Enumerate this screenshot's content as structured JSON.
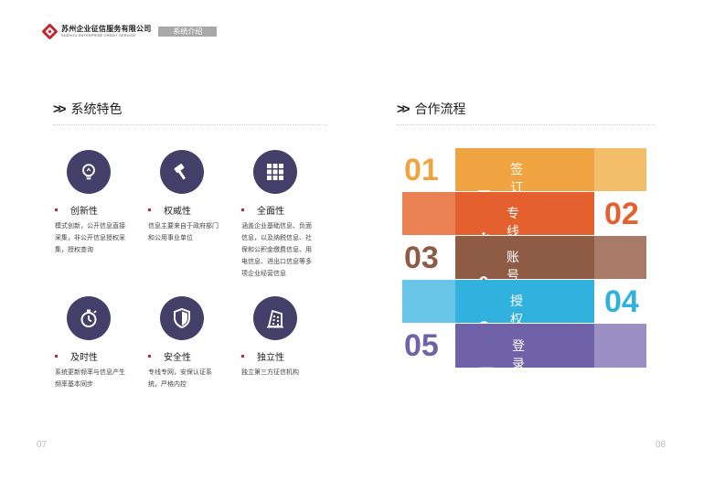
{
  "header": {
    "company_cn": "苏州企业征信服务有限公司",
    "company_en": "SUZHOU ENTERPRISE CREDIT SERVICE",
    "section_tag": "系统介绍"
  },
  "left": {
    "title": "系统特色",
    "features": [
      {
        "name": "创新性",
        "desc": "模式创新，公开信息直接采集，非公开信息授权采集，授权查询",
        "icon": "lightbulb-icon"
      },
      {
        "name": "权威性",
        "desc": "信息主要来自于政府部门和公用事业单位",
        "icon": "gavel-icon"
      },
      {
        "name": "全面性",
        "desc": "涵盖企业基础信息、负面信息，以及纳税信息、社保和公积金缴费信息、用电信息、进出口信息等多项企业经营信息",
        "icon": "grid-icon"
      },
      {
        "name": "及时性",
        "desc": "系统更新频率与信息产生频率基本同步",
        "icon": "stopwatch-icon"
      },
      {
        "name": "安全性",
        "desc": "专线专网，安保认证系统，严格内控",
        "icon": "shield-icon"
      },
      {
        "name": "独立性",
        "desc": "独立第三方征信机构",
        "icon": "building-icon"
      }
    ]
  },
  "right": {
    "title": "合作流程",
    "steps": [
      {
        "num": "01",
        "label": "签订协议",
        "icon": "edit-document-icon",
        "color": "#f0a441",
        "light": "#f4bd6a"
      },
      {
        "num": "02",
        "label": "专线连接",
        "icon": "usb-icon",
        "color": "#e4612f",
        "light": "#ea8153"
      },
      {
        "num": "03",
        "label": "账号分配",
        "icon": "key-icon",
        "color": "#8e5b44",
        "light": "#a77b65"
      },
      {
        "num": "04",
        "label": "授权征集",
        "icon": "search-icon",
        "color": "#30b1de",
        "light": "#69c5e8"
      },
      {
        "num": "05",
        "label": "登录使用",
        "icon": "laptop-icon",
        "color": "#6f62a8",
        "light": "#9b90c4"
      }
    ]
  },
  "pages": {
    "left": "07",
    "right": "08"
  }
}
